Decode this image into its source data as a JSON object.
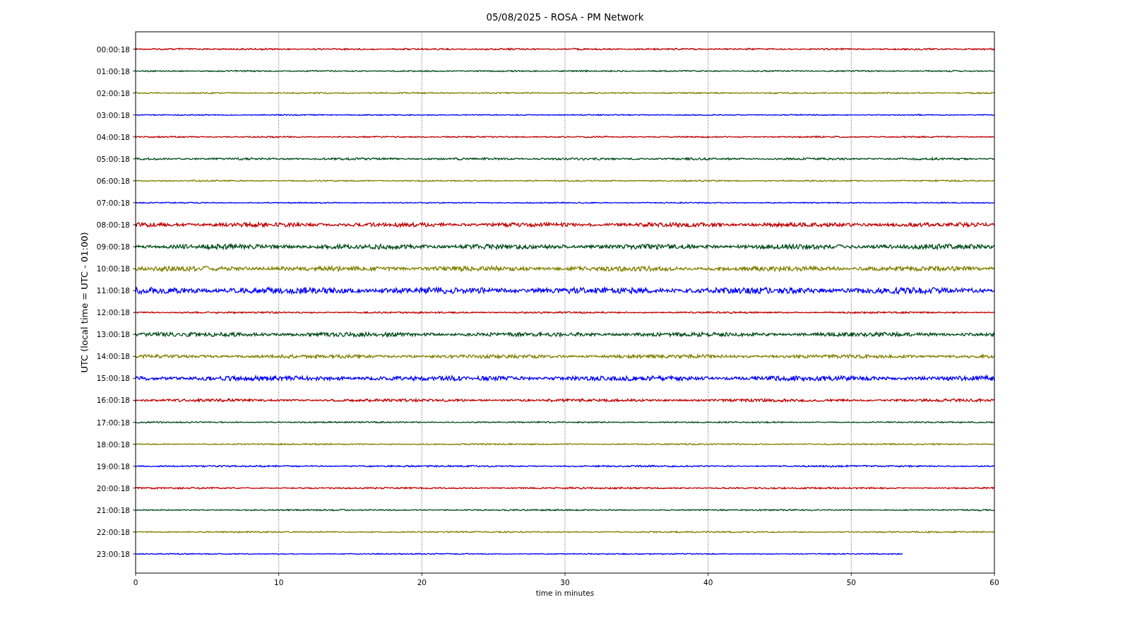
{
  "title": "05/08/2025 - ROSA - PM Network",
  "ylabel": "UTC (local time = UTC - 01:00)",
  "xlabel": "time in minutes",
  "xticks": [
    "0",
    "10",
    "20",
    "30",
    "40",
    "50",
    "60"
  ],
  "traces": [
    {
      "label": "00:00:18",
      "color": "#c00000",
      "level": 1
    },
    {
      "label": "01:00:18",
      "color": "#004d1a",
      "level": 1
    },
    {
      "label": "02:00:18",
      "color": "#808000",
      "level": 1
    },
    {
      "label": "03:00:18",
      "color": "#0000ff",
      "level": 1
    },
    {
      "label": "04:00:18",
      "color": "#c00000",
      "level": 1
    },
    {
      "label": "05:00:18",
      "color": "#004d1a",
      "level": 1
    },
    {
      "label": "06:00:18",
      "color": "#808000",
      "level": 1
    },
    {
      "label": "07:00:18",
      "color": "#0000ff",
      "level": 1
    },
    {
      "label": "08:00:18",
      "color": "#c00000",
      "level": 1
    },
    {
      "label": "09:00:18",
      "color": "#004d1a",
      "level": 1
    },
    {
      "label": "10:00:18",
      "color": "#808000",
      "level": 1
    },
    {
      "label": "11:00:18",
      "color": "#0000ff",
      "level": 1
    },
    {
      "label": "12:00:18",
      "color": "#c00000",
      "level": 1
    },
    {
      "label": "13:00:18",
      "color": "#004d1a",
      "level": 1
    },
    {
      "label": "14:00:18",
      "color": "#808000",
      "level": 1
    },
    {
      "label": "15:00:18",
      "color": "#0000ff",
      "level": 1
    },
    {
      "label": "16:00:18",
      "color": "#c00000",
      "level": 1
    },
    {
      "label": "17:00:18",
      "color": "#004d1a",
      "level": 1
    },
    {
      "label": "18:00:18",
      "color": "#808000",
      "level": 1
    },
    {
      "label": "19:00:18",
      "color": "#0000ff",
      "level": 1
    },
    {
      "label": "20:00:18",
      "color": "#c00000",
      "level": 1
    },
    {
      "label": "21:00:18",
      "color": "#004d1a",
      "level": 1
    },
    {
      "label": "22:00:18",
      "color": "#808000",
      "level": 1
    },
    {
      "label": "23:00:18",
      "color": "#0000ff",
      "level": 0.893
    }
  ]
}
